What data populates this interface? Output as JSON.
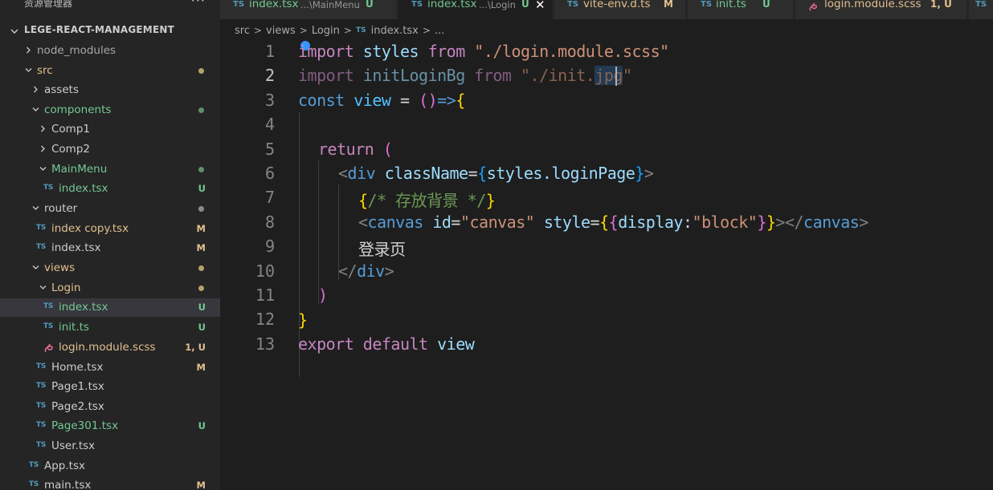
{
  "sidebar": {
    "title": "资源管理器",
    "more": "···",
    "project": "LEGE-REACT-MANAGEMENT",
    "items": [
      {
        "label": "node_modules",
        "type": "folder",
        "expanded": false,
        "color": "gray",
        "status": ""
      },
      {
        "label": "src",
        "type": "folder",
        "expanded": true,
        "color": "yellow",
        "status": "dot-yellow"
      },
      {
        "label": "assets",
        "type": "folder",
        "expanded": false,
        "color": "default",
        "status": ""
      },
      {
        "label": "components",
        "type": "folder",
        "expanded": true,
        "color": "green",
        "status": "dot-green"
      },
      {
        "label": "Comp1",
        "type": "folder",
        "expanded": false,
        "color": "default",
        "status": ""
      },
      {
        "label": "Comp2",
        "type": "folder",
        "expanded": false,
        "color": "default",
        "status": ""
      },
      {
        "label": "MainMenu",
        "type": "folder",
        "expanded": true,
        "color": "green",
        "status": "dot-green"
      },
      {
        "label": "index.tsx",
        "type": "ts",
        "color": "green",
        "status": "U"
      },
      {
        "label": "router",
        "type": "folder",
        "expanded": true,
        "color": "default",
        "status": "dot-gray"
      },
      {
        "label": "index copy.tsx",
        "type": "ts",
        "color": "yellow",
        "status": "M"
      },
      {
        "label": "index.tsx",
        "type": "ts",
        "color": "default",
        "status": "M"
      },
      {
        "label": "views",
        "type": "folder",
        "expanded": true,
        "color": "yellow",
        "status": "dot-yellow"
      },
      {
        "label": "Login",
        "type": "folder",
        "expanded": true,
        "color": "yellow",
        "status": "dot-yellow"
      },
      {
        "label": "index.tsx",
        "type": "ts",
        "color": "green",
        "status": "U"
      },
      {
        "label": "init.ts",
        "type": "ts",
        "color": "green",
        "status": "U"
      },
      {
        "label": "login.module.scss",
        "type": "scss",
        "color": "yellow",
        "status": "1, U"
      },
      {
        "label": "Home.tsx",
        "type": "ts",
        "color": "default",
        "status": "M"
      },
      {
        "label": "Page1.tsx",
        "type": "ts",
        "color": "default",
        "status": ""
      },
      {
        "label": "Page2.tsx",
        "type": "ts",
        "color": "default",
        "status": ""
      },
      {
        "label": "Page301.tsx",
        "type": "ts",
        "color": "green",
        "status": "U"
      },
      {
        "label": "User.tsx",
        "type": "ts",
        "color": "default",
        "status": ""
      },
      {
        "label": "App.tsx",
        "type": "ts",
        "color": "default",
        "status": ""
      },
      {
        "label": "main.tsx",
        "type": "ts",
        "color": "default",
        "status": "M"
      }
    ]
  },
  "tabs": [
    {
      "badge": "TS",
      "label": "index.tsx",
      "desc": "...\\MainMenu",
      "status": "U",
      "active": false
    },
    {
      "badge": "TS",
      "label": "index.tsx",
      "desc": "...\\Login",
      "status": "U",
      "active": true,
      "close": "✕"
    },
    {
      "badge": "TS",
      "label": "vite-env.d.ts",
      "desc": "",
      "status": "M",
      "active": false
    },
    {
      "badge": "TS",
      "label": "init.ts",
      "desc": "",
      "status": "U",
      "active": false
    },
    {
      "badge": "",
      "label": "login.module.scss",
      "desc": "",
      "status": "1, U",
      "active": false
    },
    {
      "badge": "TS",
      "label": "",
      "desc": "",
      "status": "",
      "active": false
    }
  ],
  "breadcrumb": {
    "parts": [
      "src",
      "views",
      "Login"
    ],
    "file_badge": "TS",
    "file": "index.tsx",
    "tail": "..."
  },
  "editor": {
    "line_numbers": [
      "1",
      "2",
      "3",
      "4",
      "5",
      "6",
      "7",
      "8",
      "9",
      "10",
      "11",
      "12",
      "13"
    ],
    "active_line": 2,
    "code": {
      "l1": {
        "k1": "import",
        "v1": " styles ",
        "k2": "from",
        "s1": " \"./login.module.scss\""
      },
      "l2": {
        "k1": "import",
        "v1": " initLoginBg ",
        "k2": "from",
        "s1": " \"./init.",
        "s2": "jpg",
        "s3": "\""
      },
      "l3": {
        "k1": "const",
        "v1": " view",
        "op": " = ",
        "p1": "()",
        "arrow": "=>",
        "b1": "{"
      },
      "l5": {
        "k1": "return",
        "p1": " ("
      },
      "l6": {
        "a1": "<",
        "t1": "div",
        "at1": " className",
        "eq": "=",
        "b1": "{",
        "v1": "styles.loginPage",
        "b2": "}",
        "a2": ">"
      },
      "l7": {
        "b1": "{",
        "c1": "/* 存放背景 */",
        "b2": "}"
      },
      "l8": {
        "a1": "<",
        "t1": "canvas",
        "at1": " id",
        "eq1": "=",
        "s1": "\"canvas\"",
        "at2": " style",
        "eq2": "=",
        "b1": "{",
        "b2": "{",
        "v1": "display",
        "col": ":",
        "s2": "\"block\"",
        "b3": "}",
        "b4": "}",
        "a2": "></",
        "t2": "canvas",
        "a3": ">"
      },
      "l9": {
        "txt": "登录页"
      },
      "l10": {
        "a1": "</",
        "t1": "div",
        "a2": ">"
      },
      "l11": {
        "p1": ")"
      },
      "l12": {
        "b1": "}"
      },
      "l13": {
        "k1": "export",
        "k2": " default",
        "v1": " view"
      }
    }
  },
  "colors": {
    "bg": "#1e1e1e",
    "sidebar_bg": "#252526",
    "selection": "#264f78",
    "git_untracked": "#73c991",
    "git_modified": "#e2c08d",
    "ts_badge": "#519aba"
  }
}
